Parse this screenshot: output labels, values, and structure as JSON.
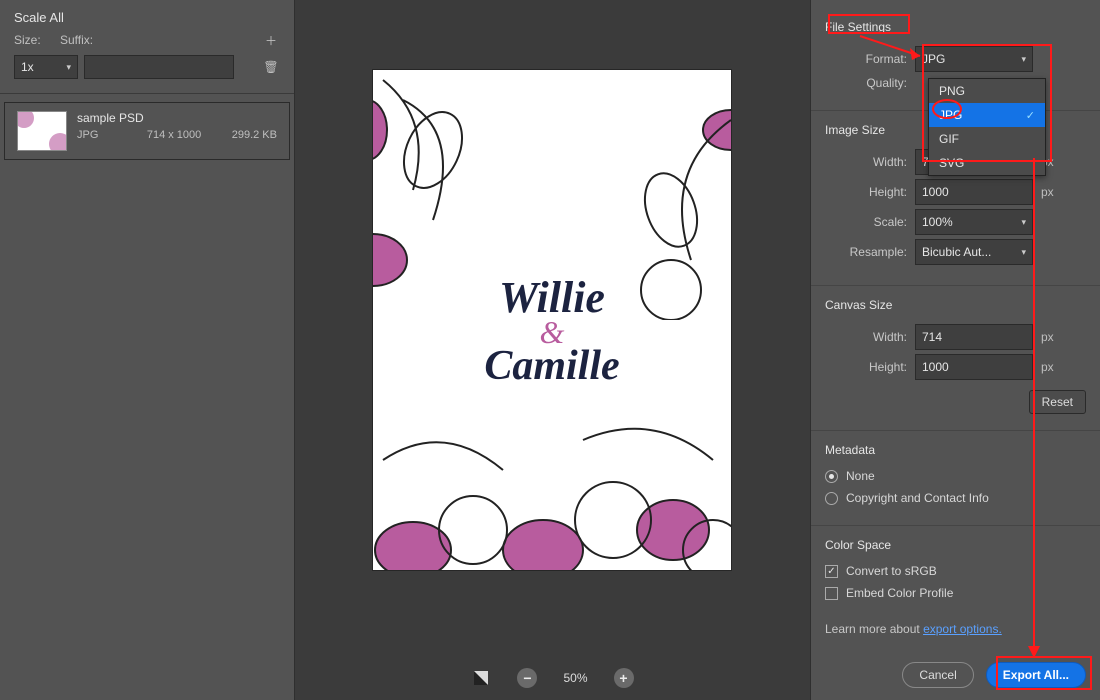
{
  "left": {
    "scale_all_title": "Scale All",
    "size_label": "Size:",
    "suffix_label": "Suffix:",
    "size_value": "1x",
    "suffix_value": "",
    "asset": {
      "name": "sample PSD",
      "format": "JPG",
      "dimensions": "714 x 1000",
      "filesize": "299.2 KB"
    }
  },
  "preview": {
    "names": {
      "first": "Willie",
      "amp": "&",
      "second": "Camille"
    },
    "zoom_percent": "50%"
  },
  "right": {
    "file_settings_title": "File Settings",
    "format_label": "Format:",
    "format_value": "JPG",
    "format_options": [
      "PNG",
      "JPG",
      "GIF",
      "SVG"
    ],
    "quality_label": "Quality:",
    "image_size_title": "Image Size",
    "image_width_label": "Width:",
    "image_width_value": "714",
    "image_height_label": "Height:",
    "image_height_value": "1000",
    "scale_label": "Scale:",
    "scale_value": "100%",
    "resample_label": "Resample:",
    "resample_value": "Bicubic Aut...",
    "canvas_size_title": "Canvas Size",
    "canvas_width_label": "Width:",
    "canvas_width_value": "714",
    "canvas_height_label": "Height:",
    "canvas_height_value": "1000",
    "reset_label": "Reset",
    "metadata_title": "Metadata",
    "metadata_none": "None",
    "metadata_copyright": "Copyright and Contact Info",
    "color_space_title": "Color Space",
    "convert_srgb": "Convert to sRGB",
    "embed_profile": "Embed Color Profile",
    "learn_prefix": "Learn more about ",
    "learn_link": "export options.",
    "cancel_label": "Cancel",
    "export_label": "Export All...",
    "px": "px"
  }
}
